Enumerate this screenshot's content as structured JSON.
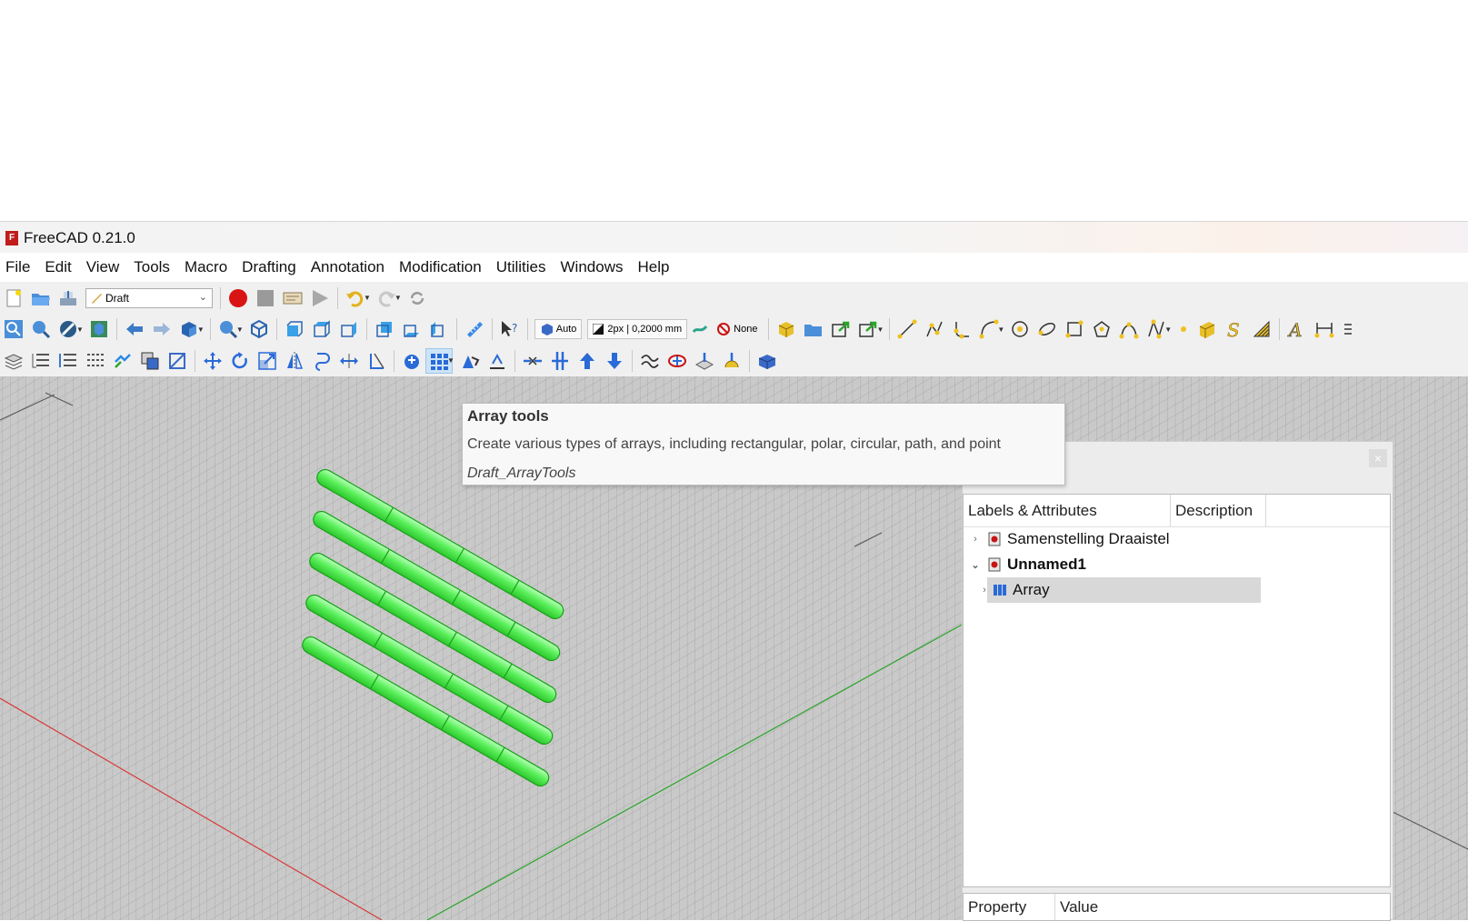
{
  "window": {
    "title": "FreeCAD 0.21.0",
    "logo_icon": "freecad-logo-icon"
  },
  "menu": [
    "File",
    "Edit",
    "View",
    "Tools",
    "Macro",
    "Drafting",
    "Annotation",
    "Modification",
    "Utilities",
    "Windows",
    "Help"
  ],
  "toolbar": {
    "workbench": "Draft",
    "auto_label": "Auto",
    "line_style": "2px | 0,2000 mm",
    "none_label": "None"
  },
  "tooltip": {
    "title": "Array tools",
    "description": "Create various types of arrays, including rectangular, polar, circular, path, and point",
    "command": "Draft_ArrayTools"
  },
  "tree": {
    "col_labels": "Labels & Attributes",
    "col_desc": "Description",
    "items": [
      {
        "label": "Samenstelling Draaistel"
      },
      {
        "label": "Unnamed1"
      },
      {
        "label": "Array"
      }
    ]
  },
  "props": {
    "col_property": "Property",
    "col_value": "Value"
  },
  "colors": {
    "selection_green": "#3cf03c",
    "x_axis": "#d83a3a",
    "y_axis": "#2aa52a"
  }
}
